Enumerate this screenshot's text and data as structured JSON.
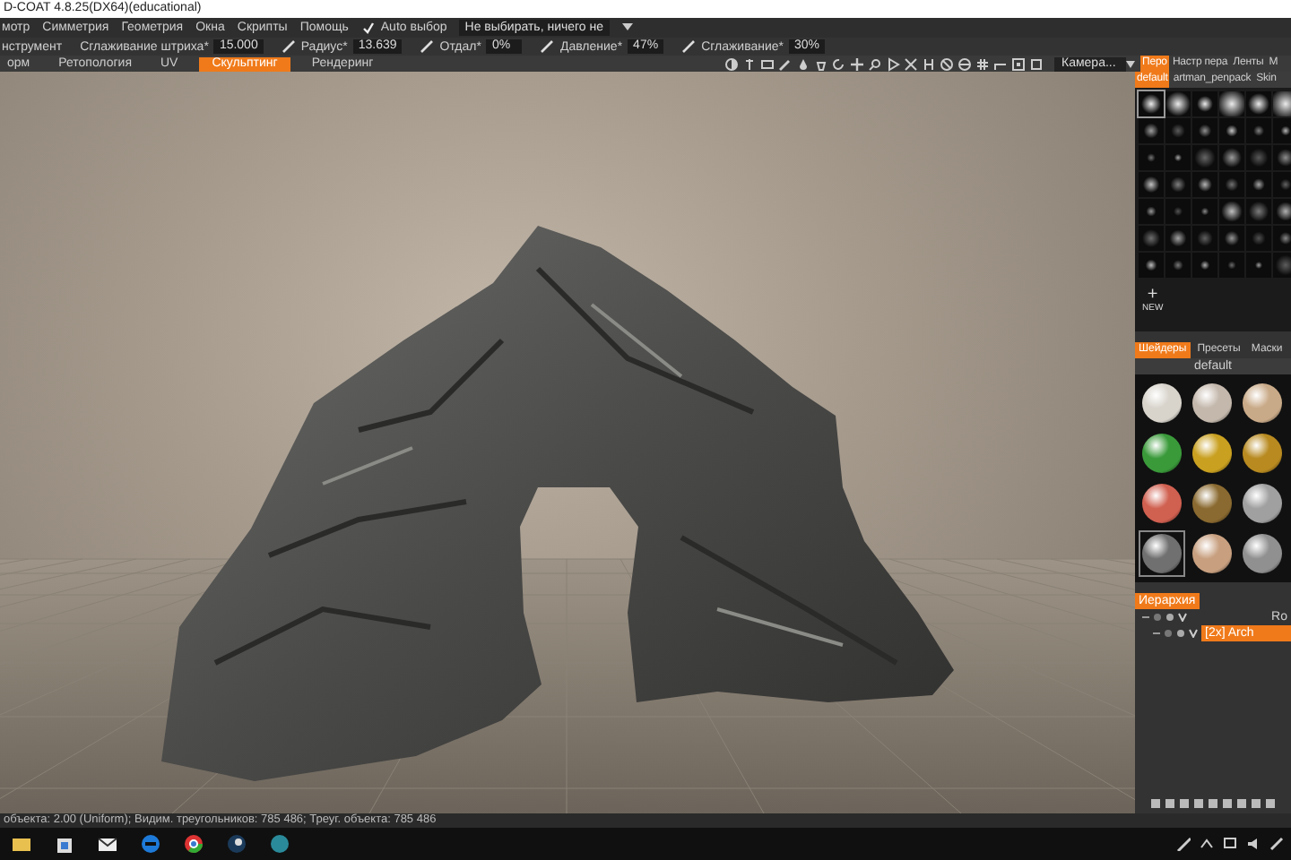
{
  "window": {
    "title": "D-COAT 4.8.25(DX64)(educational)"
  },
  "menu": [
    "мотр",
    "Симметрия",
    "Геометрия",
    "Окна",
    "Скрипты",
    "Помощь"
  ],
  "auto_select": {
    "label": "Auto выбор",
    "checked": true
  },
  "select_dropdown": {
    "value": "Не выбирать, ничего не"
  },
  "tool_options": {
    "tool_label": "нструмент",
    "fields": [
      {
        "label": "Сглаживание штриха*",
        "value": "15.000"
      },
      {
        "label": "Радиус*",
        "value": "13.639"
      },
      {
        "label": "Отдал*",
        "value": "0%"
      },
      {
        "label": "Давление*",
        "value": "47%"
      },
      {
        "label": "Сглаживание*",
        "value": "30%"
      }
    ]
  },
  "rooms": [
    {
      "label": "орм",
      "selected": false
    },
    {
      "label": "Ретопология",
      "selected": false
    },
    {
      "label": "UV",
      "selected": false
    },
    {
      "label": "Скульптинг",
      "selected": true
    },
    {
      "label": "Рендеринг",
      "selected": false
    }
  ],
  "camera_dropdown": {
    "value": "Камера..."
  },
  "brush_panel": {
    "tabs": [
      {
        "label": "Перо",
        "selected": true
      },
      {
        "label": "Настр пера",
        "selected": false
      },
      {
        "label": "Ленты",
        "selected": false
      },
      {
        "label": "М",
        "selected": false
      }
    ],
    "packs": [
      {
        "label": "default",
        "selected": true
      },
      {
        "label": "artman_penpack",
        "selected": false
      },
      {
        "label": "Skin",
        "selected": false
      }
    ],
    "new_button": {
      "icon": "+",
      "label": "NEW"
    }
  },
  "shader_panel": {
    "tabs": [
      {
        "label": "Шейдеры",
        "selected": true
      },
      {
        "label": "Пресеты",
        "selected": false
      },
      {
        "label": "Маски",
        "selected": false
      }
    ],
    "group": "default",
    "shaders": [
      {
        "color": "#d8d4cc",
        "selected": false
      },
      {
        "color": "#c4b8ac",
        "selected": false
      },
      {
        "color": "#c9aa88",
        "selected": false
      },
      {
        "color": "#3a9a3a",
        "selected": false
      },
      {
        "color": "#c9a020",
        "selected": false
      },
      {
        "color": "#b88a20",
        "selected": false
      },
      {
        "color": "#d06050",
        "selected": false
      },
      {
        "color": "#8a6a30",
        "selected": false
      },
      {
        "color": "#a0a0a0",
        "selected": false
      },
      {
        "color": "#707070",
        "selected": true
      },
      {
        "color": "#c8a080",
        "selected": false
      },
      {
        "color": "#909090",
        "selected": false
      }
    ]
  },
  "hierarchy": {
    "tab": "Иерархия",
    "items": [
      {
        "label": "Ro",
        "selected": false,
        "children": [
          {
            "label": "[2x] Arch",
            "selected": true
          }
        ]
      }
    ]
  },
  "status_bar": "объекта: 2.00 (Uniform); Видим. треугольников: 785 486; Треуг. объекта: 785 486"
}
